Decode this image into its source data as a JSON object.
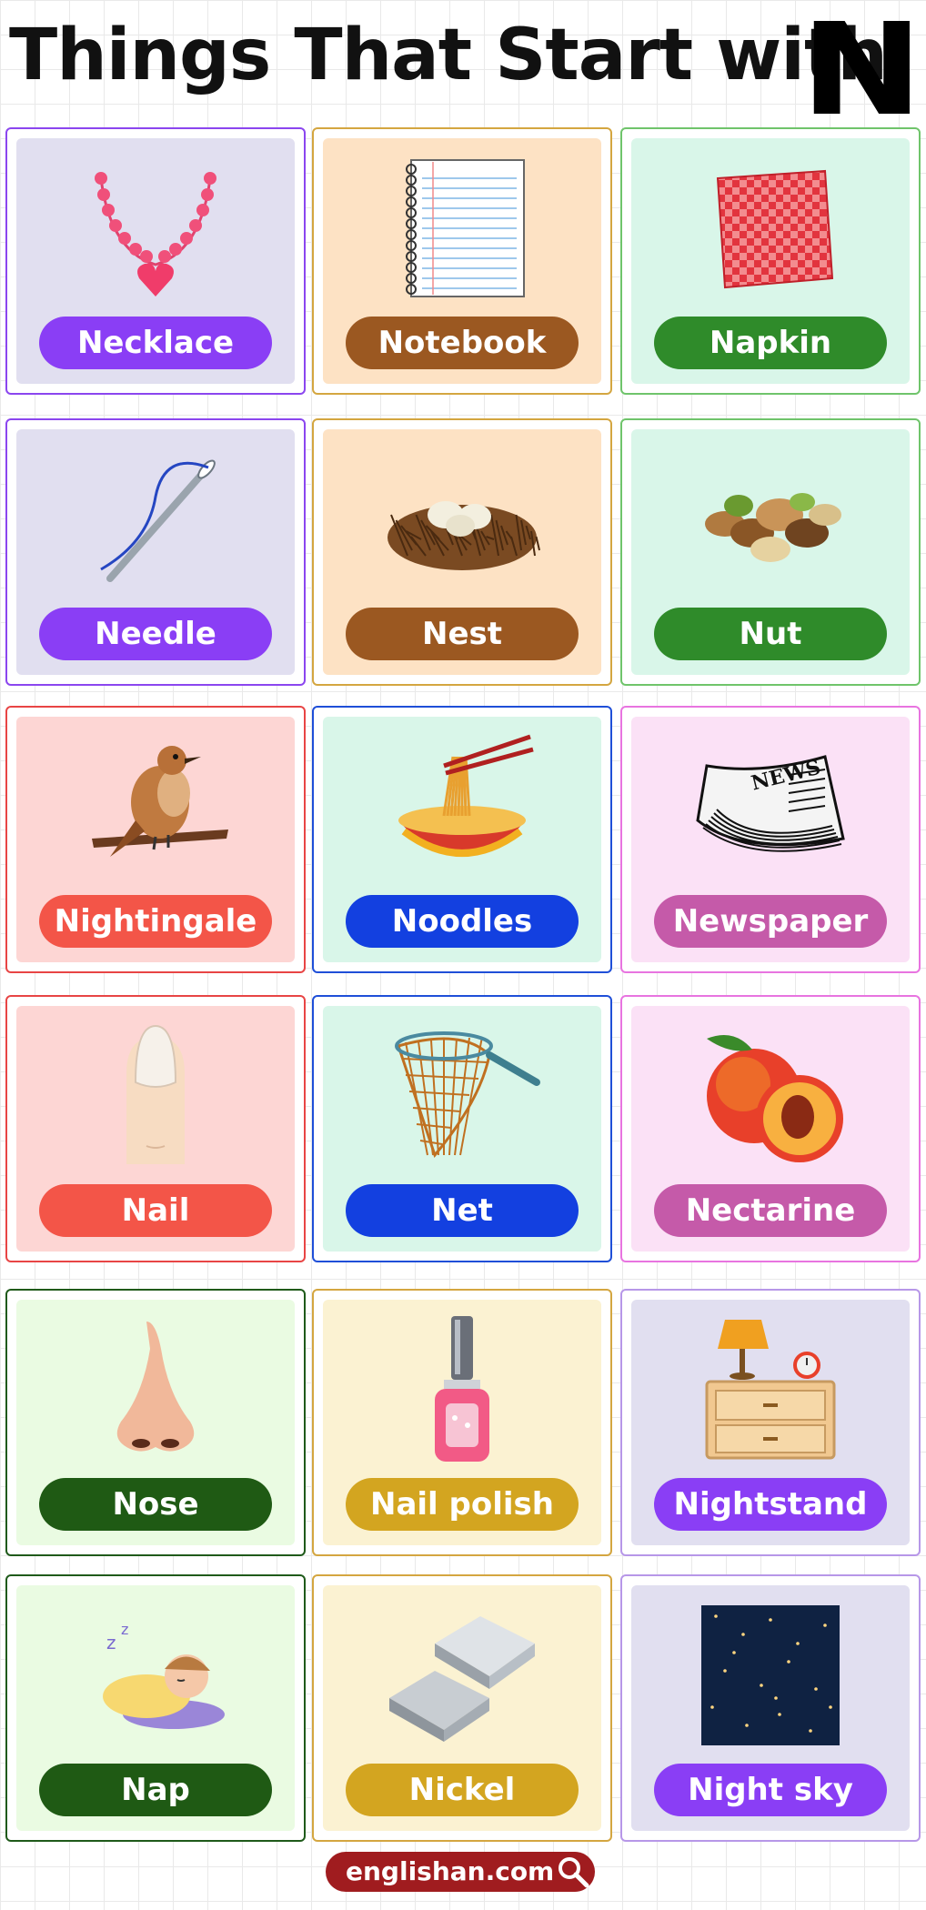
{
  "header": {
    "title": "Things That Start with",
    "letter": "N"
  },
  "items": [
    {
      "label": "Necklace",
      "icon": "necklace-icon",
      "border": "#8b46ef",
      "bg": "#e1dff0",
      "pill": "#8a3ef5"
    },
    {
      "label": "Notebook",
      "icon": "notebook-icon",
      "border": "#d4a640",
      "bg": "#fde2c4",
      "pill": "#9b5821"
    },
    {
      "label": "Napkin",
      "icon": "napkin-icon",
      "border": "#6fc46b",
      "bg": "#d9f6e9",
      "pill": "#2f8b2a"
    },
    {
      "label": "Needle",
      "icon": "needle-icon",
      "border": "#8b46ef",
      "bg": "#e1dff0",
      "pill": "#8a3ef5"
    },
    {
      "label": "Nest",
      "icon": "nest-icon",
      "border": "#d4a640",
      "bg": "#fde2c4",
      "pill": "#9b5821"
    },
    {
      "label": "Nut",
      "icon": "nut-icon",
      "border": "#6fc46b",
      "bg": "#d9f6e9",
      "pill": "#2f8b2a"
    },
    {
      "label": "Nightingale",
      "icon": "nightingale-icon",
      "border": "#e84545",
      "bg": "#fdd6d4",
      "pill": "#f35548"
    },
    {
      "label": "Noodles",
      "icon": "noodles-icon",
      "border": "#1f4fd8",
      "bg": "#d9f6e9",
      "pill": "#1340e0"
    },
    {
      "label": "Newspaper",
      "icon": "newspaper-icon",
      "border": "#e874e0",
      "bg": "#fbe1f6",
      "pill": "#c55aa9"
    },
    {
      "label": "Nail",
      "icon": "nail-icon",
      "border": "#e84545",
      "bg": "#fdd6d4",
      "pill": "#f35548"
    },
    {
      "label": "Net",
      "icon": "net-icon",
      "border": "#1f4fd8",
      "bg": "#d9f6e9",
      "pill": "#1340e0"
    },
    {
      "label": "Nectarine",
      "icon": "nectarine-icon",
      "border": "#e874e0",
      "bg": "#fbe1f6",
      "pill": "#c55aa9"
    },
    {
      "label": "Nose",
      "icon": "nose-icon",
      "border": "#1f5a1a",
      "bg": "#eafbe2",
      "pill": "#1f5a14"
    },
    {
      "label": "Nail polish",
      "icon": "nail-polish-icon",
      "border": "#d4a640",
      "bg": "#fbf2d2",
      "pill": "#d3a520"
    },
    {
      "label": "Nightstand",
      "icon": "nightstand-icon",
      "border": "#b797e8",
      "bg": "#e1dff0",
      "pill": "#8a3ef5"
    },
    {
      "label": "Nap",
      "icon": "nap-icon",
      "border": "#1f5a1a",
      "bg": "#eafbe2",
      "pill": "#1f5a14"
    },
    {
      "label": "Nickel",
      "icon": "nickel-icon",
      "border": "#d4a640",
      "bg": "#fbf2d2",
      "pill": "#d3a520"
    },
    {
      "label": "Night sky",
      "icon": "night-sky-icon",
      "border": "#b797e8",
      "bg": "#e1dff0",
      "pill": "#8a3ef5"
    }
  ],
  "footer": {
    "site": "englishan.com",
    "icon": "magnifier-icon",
    "color": "#a01c1f"
  }
}
